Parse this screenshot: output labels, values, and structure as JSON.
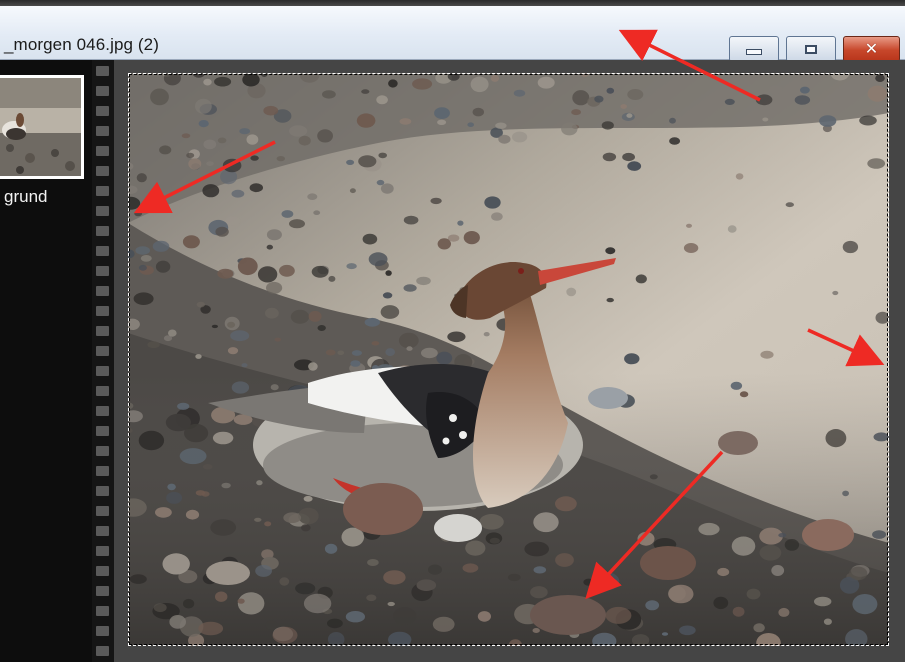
{
  "window": {
    "title": "_morgen 046.jpg (2)",
    "controls": {
      "minimize_icon": "minimize-icon",
      "maximize_icon": "maximize-icon",
      "close_icon": "close-icon",
      "close_color": "#c7472b"
    }
  },
  "layers": {
    "items": [
      {
        "label": "grund"
      }
    ]
  },
  "image": {
    "subject": "photo-canvas"
  },
  "colors": {
    "annotation_arrow": "#ee2a24",
    "panel_bg": "#0d0d0d",
    "workspace_bg": "#454545"
  }
}
